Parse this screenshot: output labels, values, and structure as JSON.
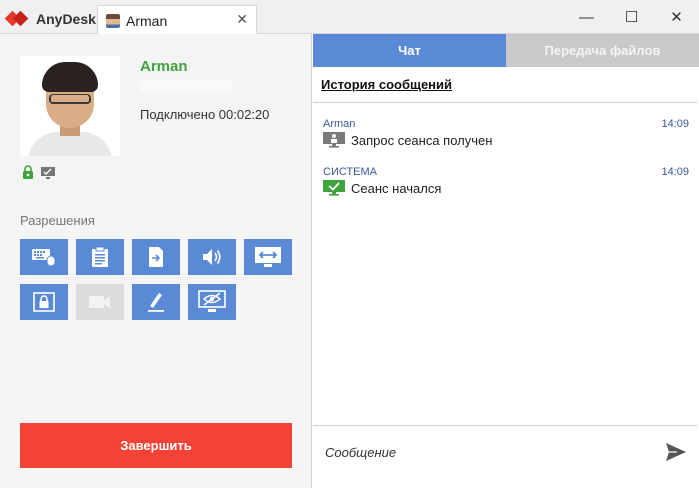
{
  "titlebar": {
    "app_name": "AnyDesk",
    "session_tab": "Arman",
    "close_tab": "✕",
    "window_controls": [
      "—",
      "☐",
      "✕"
    ]
  },
  "profile": {
    "name": "Arman",
    "status": "Подключено 00:02:20"
  },
  "permissions": {
    "title": "Разрешения",
    "items": [
      {
        "icon": "keyboard-mouse-icon",
        "enabled": true
      },
      {
        "icon": "clipboard-icon",
        "enabled": true
      },
      {
        "icon": "file-transfer-icon",
        "enabled": true
      },
      {
        "icon": "speaker-icon",
        "enabled": true
      },
      {
        "icon": "screen-arrows-icon",
        "enabled": true
      },
      {
        "icon": "lock-screen-icon",
        "enabled": true
      },
      {
        "icon": "camera-icon",
        "enabled": false
      },
      {
        "icon": "pen-icon",
        "enabled": true
      },
      {
        "icon": "privacy-mode-icon",
        "enabled": true
      }
    ]
  },
  "end_button": "Завершить",
  "tabs": {
    "chat": "Чат",
    "file_transfer": "Передача файлов"
  },
  "history": {
    "title": "История сообщений",
    "messages": [
      {
        "sender": "Arman",
        "time": "14:09",
        "text": "Запрос сеанса получен",
        "icon": "session-request-icon"
      },
      {
        "sender": "СИСТЕМА",
        "time": "14:09",
        "text": "Сеанс начался",
        "icon": "session-started-icon"
      }
    ]
  },
  "input": {
    "placeholder": "Сообщение"
  },
  "colors": {
    "accent": "#5a8ad6",
    "end": "#f44336",
    "name": "#3fa33f",
    "brand": "#e8382b"
  }
}
